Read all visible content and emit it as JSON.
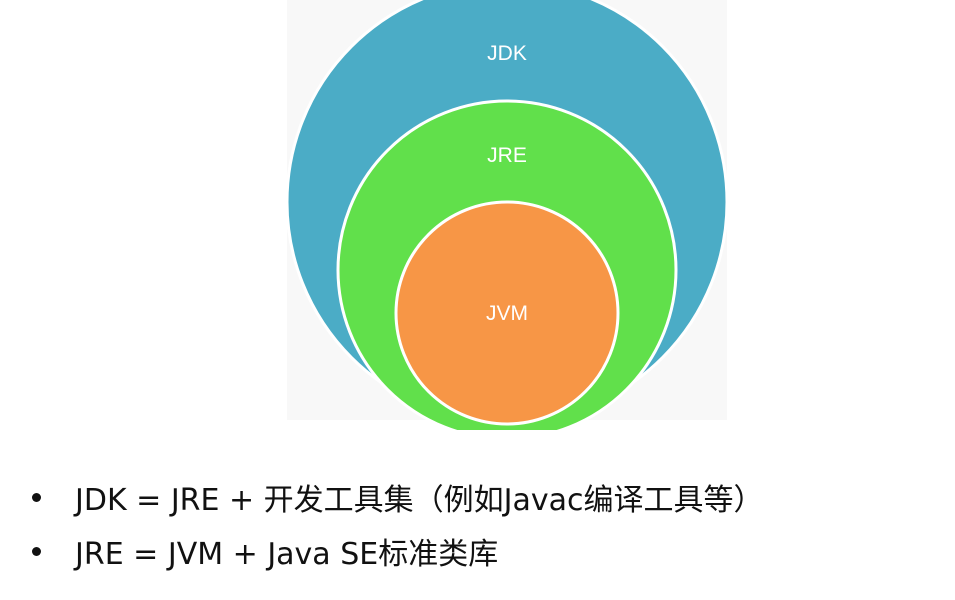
{
  "diagram": {
    "circles": [
      {
        "label": "JDK",
        "color": "#4bacc6"
      },
      {
        "label": "JRE",
        "color": "#61e04b"
      },
      {
        "label": "JVM",
        "color": "#f79646"
      }
    ],
    "outline_color": "#ffffff"
  },
  "bullets": [
    {
      "text": "JDK = JRE + 开发工具集（例如Javac编译工具等）"
    },
    {
      "text": "JRE = JVM + Java SE标准类库"
    }
  ]
}
